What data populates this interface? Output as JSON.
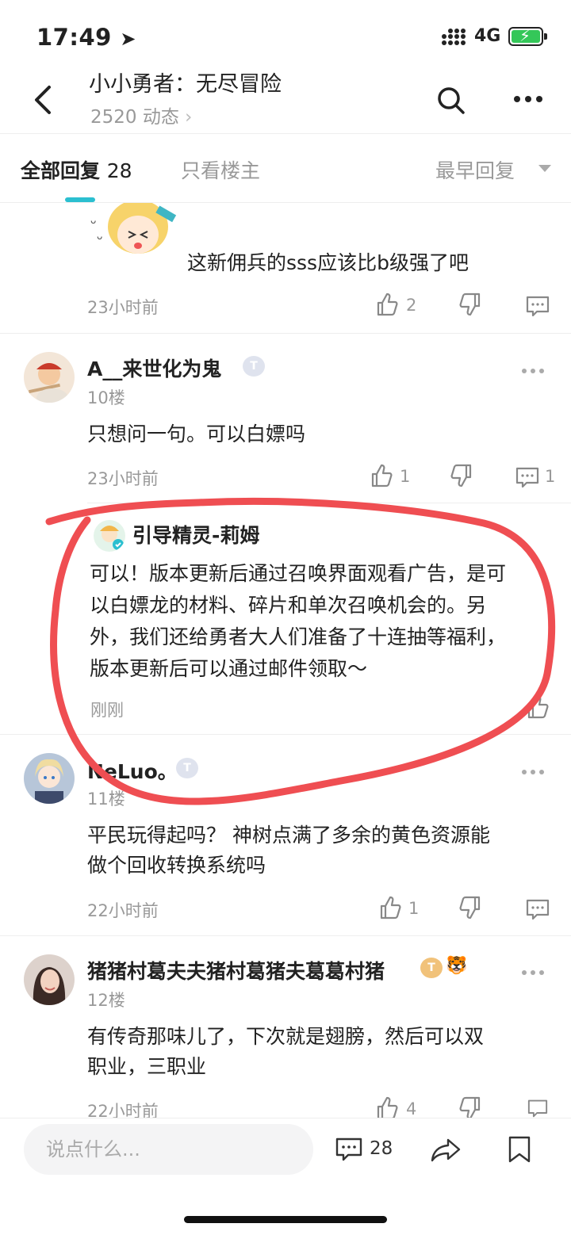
{
  "status": {
    "time": "17:49",
    "network": "4G"
  },
  "nav": {
    "title": "小小勇者：无尽冒险",
    "subtitle": "2520 动态"
  },
  "tabs": {
    "all_label": "全部回复",
    "all_count": "28",
    "owner_only": "只看楼主",
    "sort": "最早回复"
  },
  "comments": [
    {
      "text": "这新佣兵的sss应该比b级强了吧",
      "time": "23小时前",
      "likes": "2",
      "replies": ""
    },
    {
      "name": "A__来世化为鬼",
      "floor": "10楼",
      "text": "只想问一句。可以白嫖吗",
      "time": "23小时前",
      "likes": "1",
      "replies": "1"
    },
    {
      "name": "NeLuo。",
      "floor": "11楼",
      "text_lines": [
        "平民玩得起吗？ 神树点满了多余的黄色资源能",
        "做个回收转换系统吗"
      ],
      "time": "22小时前",
      "likes": "1"
    },
    {
      "name": "猪猪村葛夫夫猪村葛猪夫葛葛村猪",
      "floor": "12楼",
      "text_lines": [
        "有传奇那味儿了，下次就是翅膀，然后可以双",
        "职业，三职业"
      ],
      "time": "22小时前",
      "likes": "4"
    }
  ],
  "reply": {
    "name": "引导精灵-莉姆",
    "lines": [
      "可以！版本更新后通过召唤界面观看广告，是可",
      "以白嫖龙的材料、碎片和单次召唤机会的。另",
      "外，我们还给勇者大人们准备了十连抽等福利，",
      "版本更新后可以通过邮件领取～"
    ],
    "time": "刚刚"
  },
  "bottom": {
    "placeholder": "说点什么...",
    "comment_count": "28"
  },
  "colors": {
    "accent": "#2bbfd0",
    "annotation": "#ef4e52",
    "muted": "#999999"
  },
  "icons": [
    "back-icon",
    "search-icon",
    "more-icon",
    "like-icon",
    "dislike-icon",
    "comment-icon",
    "share-icon",
    "bookmark-icon"
  ]
}
